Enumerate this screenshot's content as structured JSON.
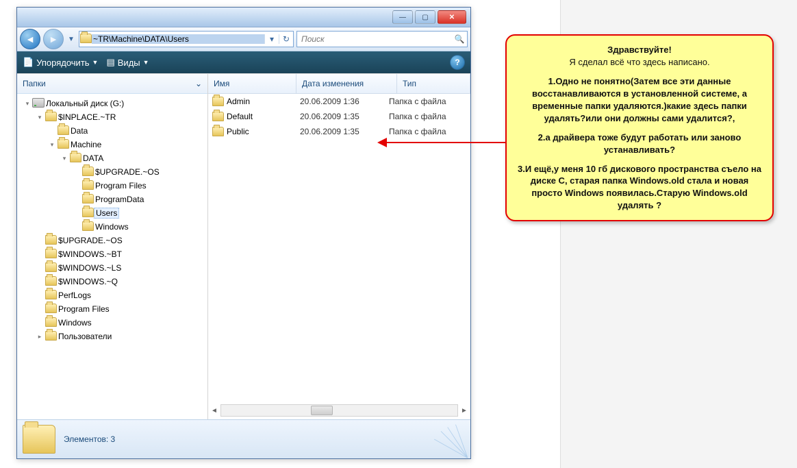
{
  "window": {
    "path": "~TR\\Machine\\DATA\\Users",
    "search_placeholder": "Поиск"
  },
  "toolbar": {
    "organize": "Упорядочить",
    "views": "Виды"
  },
  "nav_header": "Папки",
  "tree": [
    {
      "label": "Локальный диск (G:)",
      "indent": 0,
      "icon": "drive",
      "exp": "▾"
    },
    {
      "label": "$INPLACE.~TR",
      "indent": 1,
      "icon": "folder",
      "exp": "▾"
    },
    {
      "label": "Data",
      "indent": 2,
      "icon": "folder",
      "exp": ""
    },
    {
      "label": "Machine",
      "indent": 2,
      "icon": "folder",
      "exp": "▾"
    },
    {
      "label": "DATA",
      "indent": 3,
      "icon": "folder",
      "exp": "▾"
    },
    {
      "label": "$UPGRADE.~OS",
      "indent": 4,
      "icon": "folder",
      "exp": ""
    },
    {
      "label": "Program Files",
      "indent": 4,
      "icon": "folder",
      "exp": ""
    },
    {
      "label": "ProgramData",
      "indent": 4,
      "icon": "folder",
      "exp": ""
    },
    {
      "label": "Users",
      "indent": 4,
      "icon": "folder",
      "exp": "",
      "selected": true
    },
    {
      "label": "Windows",
      "indent": 4,
      "icon": "folder",
      "exp": ""
    },
    {
      "label": "$UPGRADE.~OS",
      "indent": 1,
      "icon": "folder",
      "exp": ""
    },
    {
      "label": "$WINDOWS.~BT",
      "indent": 1,
      "icon": "folder",
      "exp": ""
    },
    {
      "label": "$WINDOWS.~LS",
      "indent": 1,
      "icon": "folder",
      "exp": ""
    },
    {
      "label": "$WINDOWS.~Q",
      "indent": 1,
      "icon": "folder",
      "exp": ""
    },
    {
      "label": "PerfLogs",
      "indent": 1,
      "icon": "folder",
      "exp": ""
    },
    {
      "label": "Program Files",
      "indent": 1,
      "icon": "folder",
      "exp": ""
    },
    {
      "label": "Windows",
      "indent": 1,
      "icon": "folder",
      "exp": ""
    },
    {
      "label": "Пользователи",
      "indent": 1,
      "icon": "folder",
      "exp": "▸"
    }
  ],
  "columns": {
    "name": "Имя",
    "date": "Дата изменения",
    "type": "Тип"
  },
  "files": [
    {
      "name": "Admin",
      "date": "20.06.2009 1:36",
      "type": "Папка с файла"
    },
    {
      "name": "Default",
      "date": "20.06.2009 1:35",
      "type": "Папка с файла"
    },
    {
      "name": "Public",
      "date": "20.06.2009 1:35",
      "type": "Папка с файла"
    }
  ],
  "status": "Элементов: 3",
  "callout": {
    "hello": "Здравствуйте!",
    "line1": "Я сделал всё что здесь написано.",
    "p1": "1.Одно не понятно(Затем все эти данные восстанавливаются в установленной системе, а временные папки удаляются.)какие здесь папки удалять?или они должны сами удалится?,",
    "p2": "2.а драйвера тоже будут работать или заново устанавливать?",
    "p3": "3.И ещё,у меня 10 гб дискового пространства съело на диске С, старая папка Windows.old стала и новая просто Windows появилась.Старую Windows.old удалять ?"
  }
}
